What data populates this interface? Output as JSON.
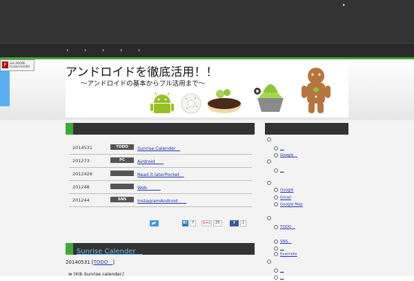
{
  "colors": {
    "dark": "#333333",
    "accent_green": "#3faa33",
    "link": "#1a2ea8",
    "article_title": "#6bc0ff"
  },
  "topbar": {
    "corner_mark": "▸"
  },
  "nav": {
    "chevrons": [
      "›",
      "›",
      "›",
      "›",
      "›"
    ]
  },
  "flash_badge": {
    "icon": "F",
    "text": "Get ADOBE FLASH PLAYER"
  },
  "banner": {
    "title": "アンドロイドを徹底活用！！",
    "subtitle": "～アンドロイドの基本からフル活用まで～",
    "icon_names": [
      "android-robot-icon",
      "donut-icon",
      "eclair-icon",
      "froyo-icon",
      "gingerbread-icon"
    ]
  },
  "posts": [
    {
      "date": "2014531",
      "category": "TODO",
      "title": "Sunrise Calender　"
    },
    {
      "date": "201273",
      "category": "PC",
      "title": "Airdroid　　"
    },
    {
      "date": "2012426",
      "category": "",
      "title": "Read it laterPocket　"
    },
    {
      "date": "201248",
      "category": "",
      "title": "Web　　　"
    },
    {
      "date": "201244",
      "category": "SNS",
      "title": "InstagramAndroid　　"
    }
  ],
  "share": {
    "twitter_icon": "twitter-icon",
    "hatena_label": "B!",
    "hatena_count": "7",
    "gplus_label": "G+1",
    "gplus_count": "25",
    "facebook_label": "f",
    "facebook_count": "1"
  },
  "article": {
    "title": "Sunrise Calender　",
    "date": "20140531 [",
    "category": "TODO　",
    "close": "]",
    "excerpt": "w (¥)b Sunrise calender♪"
  },
  "sidebar": {
    "items": [
      {
        "level": 0,
        "label": ""
      },
      {
        "level": 1,
        "label": "＿"
      },
      {
        "level": 1,
        "label": "Google　"
      },
      {
        "level": 0,
        "label": ""
      },
      {
        "level": 1,
        "label": "＿"
      },
      {
        "level": 0,
        "label": ""
      },
      {
        "level": 1,
        "label": "Google"
      },
      {
        "level": 1,
        "label": "Gmail"
      },
      {
        "level": 1,
        "label": "Google Map"
      },
      {
        "level": 0,
        "label": ""
      },
      {
        "level": 1,
        "label": "TODO　"
      },
      {
        "level": 1,
        "label": "SNS　"
      },
      {
        "level": 1,
        "label": "＿"
      },
      {
        "level": 1,
        "label": "Evernote"
      },
      {
        "level": 0,
        "label": ""
      },
      {
        "level": 1,
        "label": "＿"
      },
      {
        "level": 1,
        "label": "＿"
      }
    ]
  }
}
